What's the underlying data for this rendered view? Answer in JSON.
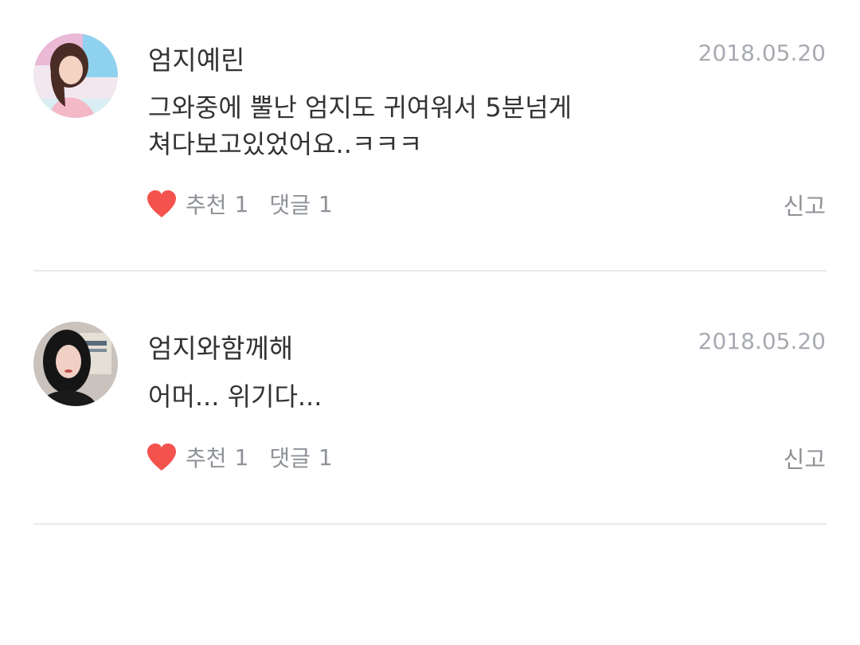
{
  "comments": [
    {
      "author": "엄지예린",
      "date": "2018.05.20",
      "text_lines": [
        "그와중에 뿔난 엄지도 귀여워서 5분넘게",
        "쳐다보고있었어요..ㅋㅋㅋ"
      ],
      "like_label": "추천",
      "like_count": "1",
      "reply_label": "댓글",
      "reply_count": "1",
      "report_label": "신고"
    },
    {
      "author": "엄지와함께해",
      "date": "2018.05.20",
      "text_lines": [
        "어머... 위기다..."
      ],
      "like_label": "추천",
      "like_count": "1",
      "reply_label": "댓글",
      "reply_count": "1",
      "report_label": "신고"
    }
  ],
  "icons": {
    "heart": "heart-icon"
  },
  "colors": {
    "heart": "#f4524d",
    "text": "#333333",
    "meta": "#8e9297",
    "date": "#a7abb1",
    "divider": "#e8e9eb"
  }
}
